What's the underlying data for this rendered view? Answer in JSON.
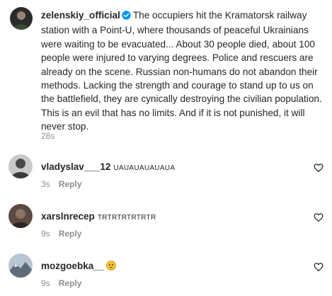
{
  "post": {
    "username": "zelenskiy_official",
    "text": "The occupiers hit the Kramatorsk railway station with a Point-U, where thousands of peaceful Ukrainians were waiting to be evacuated... About 30 people died, about 100 people were injured to varying degrees. Police and rescuers are already on the scene. Russian non-humans do not abandon their methods. Lacking the strength and courage to stand up to us on the battlefield, they are cynically destroying the civilian population. This is an evil that has no limits. And if it is not punished, it will never stop.",
    "time": "28s",
    "avatar_icon": "profile-photo-icon",
    "verified_icon": "verified-badge-icon",
    "verified_color": "#0095f6"
  },
  "comments": [
    {
      "username": "vladyslav___12",
      "text": "UAUAUAUAUAUA",
      "time": "3s",
      "reply_label": "Reply",
      "like_icon": "heart-outline-icon"
    },
    {
      "username": "xarslnrecep",
      "text": "TRTRTRTRTRTR",
      "time": "9s",
      "reply_label": "Reply",
      "like_icon": "heart-outline-icon"
    },
    {
      "username": "mozgoebka__",
      "text": "",
      "emoji": "sad-face-emoji",
      "time": "9s",
      "reply_label": "Reply",
      "like_icon": "heart-outline-icon"
    }
  ]
}
